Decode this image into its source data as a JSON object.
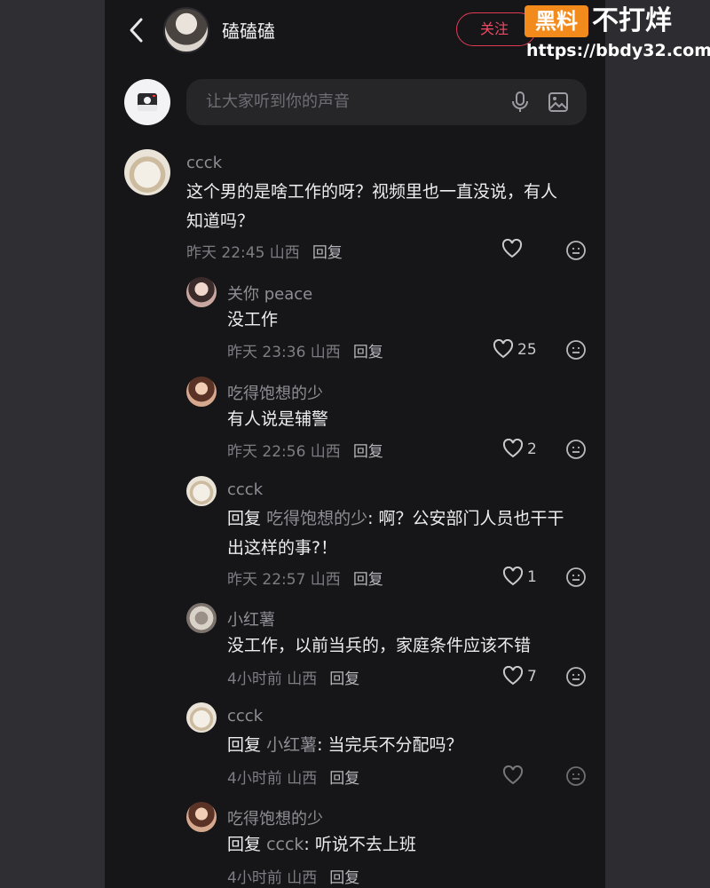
{
  "header": {
    "user_name": "磕磕磕",
    "follow_label": "关注"
  },
  "watermark": {
    "logo_text": "黑料",
    "slogan": "不打烊",
    "url": "https://bbdy32.com"
  },
  "composer": {
    "placeholder": "让大家听到你的声音"
  },
  "comments": [
    {
      "user": "ccck",
      "text_line1": "这个男的是啥工作的呀？视频里也一直没说，有人",
      "text_line2": "知道吗？",
      "time": "昨天 22:45 山西",
      "reply_label": "回复",
      "likes": ""
    },
    {
      "user": "关你 peace",
      "text_line1": "没工作",
      "time": "昨天 23:36 山西",
      "reply_label": "回复",
      "likes": "25"
    },
    {
      "user": "吃得饱想的少",
      "text_line1": "有人说是辅警",
      "time": "昨天 22:56 山西",
      "reply_label": "回复",
      "likes": "2"
    },
    {
      "user": "ccck",
      "reply_prefix": "回复",
      "reply_target": "吃得饱想的少",
      "text_line1": ": 啊？公安部门人员也干干",
      "text_line2": "出这样的事?！",
      "time": "昨天 22:57 山西",
      "reply_label": "回复",
      "likes": "1"
    },
    {
      "user": "小红薯",
      "text_line1": "没工作，以前当兵的，家庭条件应该不错",
      "time": "4小时前 山西",
      "reply_label": "回复",
      "likes": "7"
    },
    {
      "user": "ccck",
      "reply_prefix": "回复",
      "reply_target": "小红薯",
      "text_line1": ": 当完兵不分配吗？",
      "time": "4小时前 山西",
      "reply_label": "回复",
      "likes": ""
    },
    {
      "user": "吃得饱想的少",
      "reply_prefix": "回复",
      "reply_target": "ccck",
      "text_line1": ": 听说不去上班",
      "time": "4小时前 山西",
      "reply_label": "回复",
      "likes": ""
    }
  ],
  "colors": {
    "background": "#161619",
    "accent": "#e23b55",
    "primary_text": "#ededf0",
    "secondary_text": "#8e8e94"
  }
}
